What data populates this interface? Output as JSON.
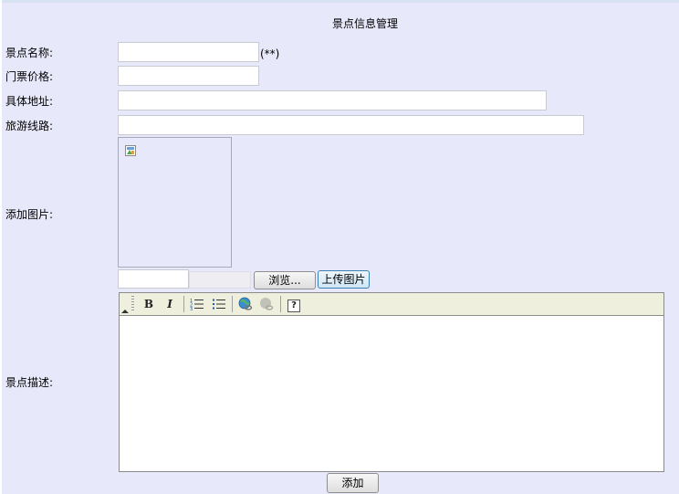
{
  "page": {
    "title": "景点信息管理"
  },
  "form": {
    "name_label": "景点名称:",
    "name_value": "",
    "required_mark": "(**)",
    "price_label": "门票价格:",
    "price_value": "",
    "address_label": "具体地址:",
    "address_value": "",
    "route_label": "旅游线路:",
    "route_value": "",
    "image_label": "添加图片:",
    "image_path_value": "",
    "browse_button": "浏览...",
    "upload_button": "上传图片",
    "description_label": "景点描述:",
    "submit_button": "添加"
  },
  "editor": {
    "toolbar": [
      {
        "name": "bold",
        "glyph": "B"
      },
      {
        "name": "italic",
        "glyph": "I"
      },
      {
        "name": "ordered-list",
        "glyph": ""
      },
      {
        "name": "unordered-list",
        "glyph": ""
      },
      {
        "name": "insert-link",
        "glyph": ""
      },
      {
        "name": "remove-link",
        "glyph": ""
      },
      {
        "name": "help",
        "glyph": "?"
      }
    ]
  }
}
